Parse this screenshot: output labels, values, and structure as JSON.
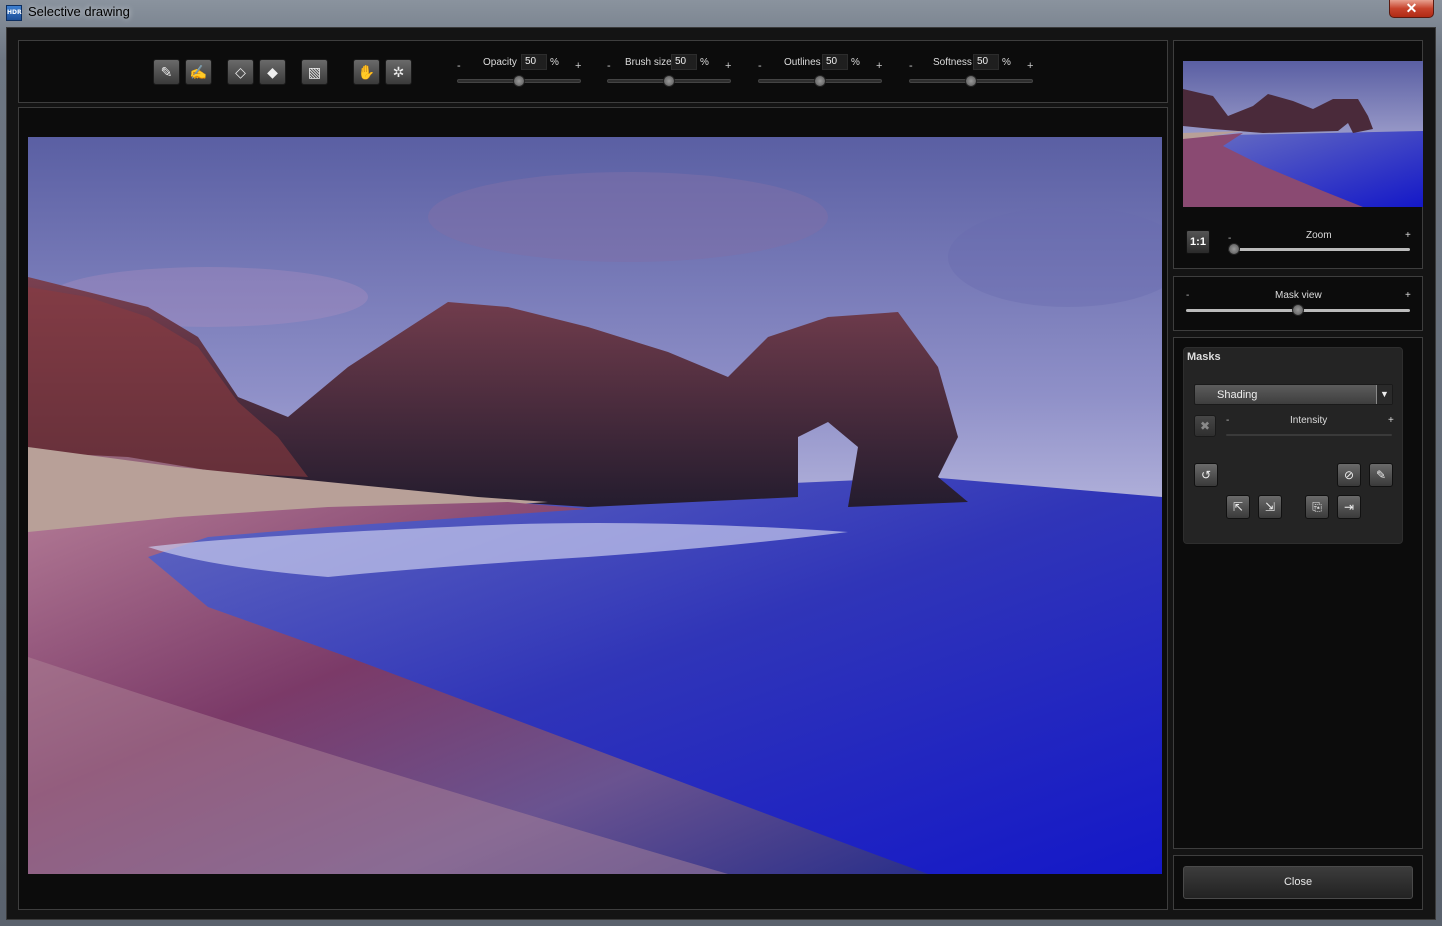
{
  "window": {
    "title": "Selective drawing",
    "app_icon": "HDR",
    "close_glyph": "✕"
  },
  "toolbar": {
    "tools": [
      {
        "name": "brush-icon",
        "glyph": "✎"
      },
      {
        "name": "brush-soft-icon",
        "glyph": "✍"
      },
      {
        "name": "eraser-icon",
        "glyph": "◇"
      },
      {
        "name": "eraser-soft-icon",
        "glyph": "◆"
      },
      {
        "name": "fill-bucket-icon",
        "glyph": "▧"
      },
      {
        "name": "auto-select-icon",
        "glyph": "✋"
      },
      {
        "name": "magic-wand-icon",
        "glyph": "✲"
      }
    ],
    "sliders": [
      {
        "label": "Opacity",
        "value": "50",
        "unit": "%",
        "minus": "-",
        "plus": "+",
        "level": 0.5
      },
      {
        "label": "Brush size",
        "value": "50",
        "unit": "%",
        "minus": "-",
        "plus": "+",
        "level": 0.5
      },
      {
        "label": "Outlines",
        "value": "50",
        "unit": "%",
        "minus": "-",
        "plus": "+",
        "level": 0.5
      },
      {
        "label": "Softness",
        "value": "50",
        "unit": "%",
        "minus": "-",
        "plus": "+",
        "level": 0.5
      }
    ]
  },
  "navigator": {
    "one_to_one": "1:1",
    "zoom_label": "Zoom",
    "minus": "-",
    "plus": "+",
    "zoom_level": 0.0
  },
  "mask_view": {
    "label": "Mask view",
    "minus": "-",
    "plus": "+",
    "level": 0.5
  },
  "masks": {
    "title": "Masks",
    "selected": "Shading",
    "dropdown_arrow": "▼",
    "intensity_label": "Intensity",
    "minus": "-",
    "plus": "+",
    "delete_glyph": "✖",
    "undo_glyph": "↺",
    "invert_glyph": "⊘",
    "pick_glyph": "✎",
    "action_glyphs": [
      "⇱",
      "⇲",
      "⎘",
      "⇥"
    ]
  },
  "footer": {
    "close_label": "Close"
  }
}
